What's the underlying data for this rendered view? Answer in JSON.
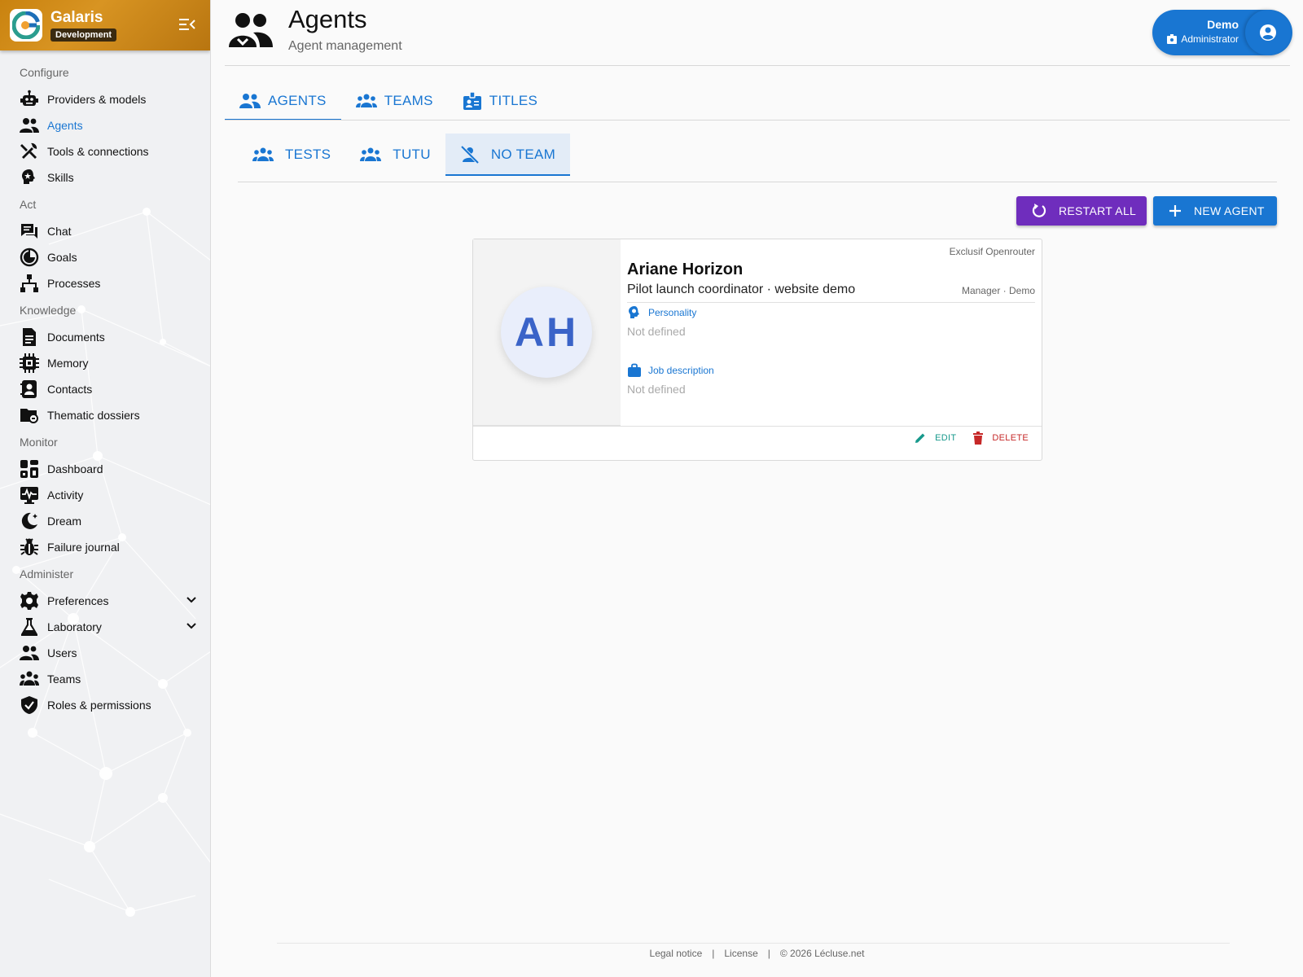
{
  "brand": {
    "name": "Galaris",
    "env": "Development"
  },
  "sidebar": {
    "sections": [
      {
        "title": "Configure",
        "items": [
          {
            "label": "Providers & models",
            "icon": "robot-icon"
          },
          {
            "label": "Agents",
            "icon": "agents-icon",
            "active": true
          },
          {
            "label": "Tools & connections",
            "icon": "tools-icon"
          },
          {
            "label": "Skills",
            "icon": "skills-icon"
          }
        ]
      },
      {
        "title": "Act",
        "items": [
          {
            "label": "Chat",
            "icon": "chat-icon"
          },
          {
            "label": "Goals",
            "icon": "goals-icon"
          },
          {
            "label": "Processes",
            "icon": "processes-icon"
          }
        ]
      },
      {
        "title": "Knowledge",
        "items": [
          {
            "label": "Documents",
            "icon": "document-icon"
          },
          {
            "label": "Memory",
            "icon": "memory-icon"
          },
          {
            "label": "Contacts",
            "icon": "contacts-icon"
          },
          {
            "label": "Thematic dossiers",
            "icon": "folder-icon"
          }
        ]
      },
      {
        "title": "Monitor",
        "items": [
          {
            "label": "Dashboard",
            "icon": "dashboard-icon"
          },
          {
            "label": "Activity",
            "icon": "activity-icon"
          },
          {
            "label": "Dream",
            "icon": "dream-icon"
          },
          {
            "label": "Failure journal",
            "icon": "bug-icon"
          }
        ]
      },
      {
        "title": "Administer",
        "items": [
          {
            "label": "Preferences",
            "icon": "gear-icon",
            "expandable": true
          },
          {
            "label": "Laboratory",
            "icon": "flask-icon",
            "expandable": true
          },
          {
            "label": "Users",
            "icon": "users-icon"
          },
          {
            "label": "Teams",
            "icon": "teams-icon"
          },
          {
            "label": "Roles & permissions",
            "icon": "shield-icon"
          }
        ]
      }
    ]
  },
  "header": {
    "title": "Agents",
    "subtitle": "Agent management"
  },
  "user": {
    "name": "Demo",
    "role": "Administrator"
  },
  "tabs": [
    {
      "label": "AGENTS",
      "active": true
    },
    {
      "label": "TEAMS"
    },
    {
      "label": "TITLES"
    }
  ],
  "subtabs": [
    {
      "label": "TESTS"
    },
    {
      "label": "TUTU"
    },
    {
      "label": "NO TEAM",
      "active": true
    }
  ],
  "actions": {
    "restart_all": "RESTART ALL",
    "new_agent": "NEW AGENT"
  },
  "agent": {
    "initials": "AH",
    "provider": "Exclusif Openrouter",
    "name": "Ariane Horizon",
    "title": "Pilot launch coordinator · website demo",
    "meta": "Manager · Demo",
    "personality_label": "Personality",
    "personality_value": "Not defined",
    "job_label": "Job description",
    "job_value": "Not defined",
    "edit": "EDIT",
    "delete": "DELETE"
  },
  "footer": {
    "legal": "Legal notice",
    "sep": "|",
    "license": "License",
    "copyright": "© 2026 Lécluse.net"
  },
  "colors": {
    "primary": "#1976d2",
    "restart": "#6f2dbd",
    "brand": "#c9820f",
    "edit": "#17998c",
    "delete": "#c62828"
  }
}
